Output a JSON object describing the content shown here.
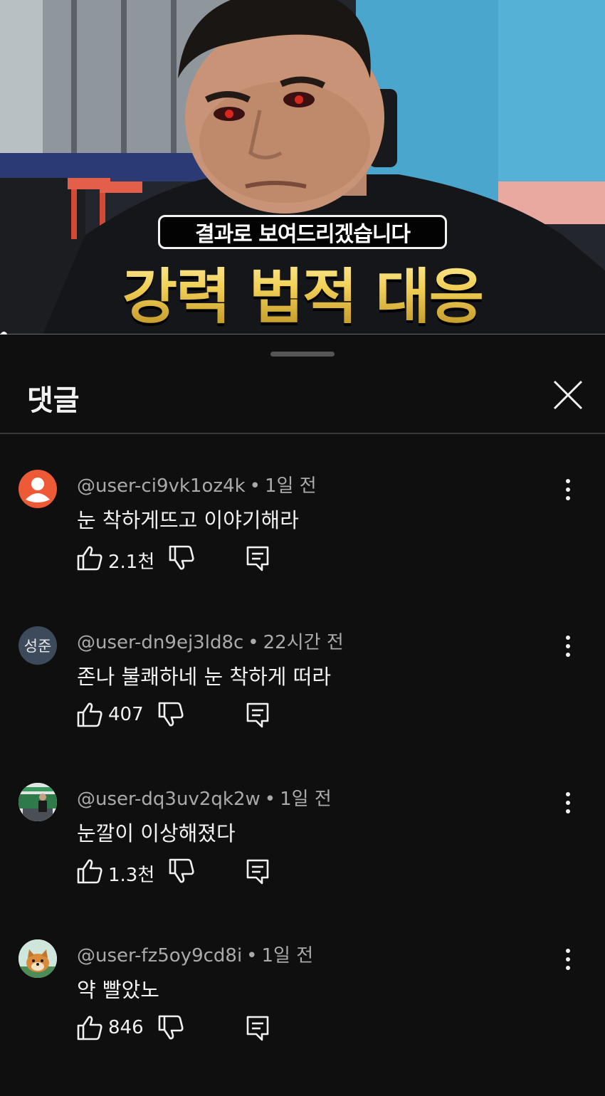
{
  "video": {
    "caption": "결과로 보여드리겠습니다",
    "headline": "강력 법적 대응",
    "progress_fraction": 0.005
  },
  "sheet": {
    "title": "댓글"
  },
  "comments": [
    {
      "author": "@user-ci9vk1oz4k",
      "time": "1일 전",
      "text": "눈 착하게뜨고 이야기해라",
      "likes": "2.1천",
      "avatar": "default-person-icon",
      "avatar_color": "#ef5a36"
    },
    {
      "author": "@user-dn9ej3ld8c",
      "time": "22시간 전",
      "text": "존나 불쾌하네 눈 착하게 떠라",
      "likes": "407",
      "avatar_initials": "성준",
      "avatar_color": "#3d4a5b"
    },
    {
      "author": "@user-dq3uv2qk2w",
      "time": "1일 전",
      "text": "눈깔이 이상해졌다",
      "likes": "1.3천",
      "avatar": "photo-avatar"
    },
    {
      "author": "@user-fz5oy9cd8i",
      "time": "1일 전",
      "text": "약 빨았노",
      "likes": "846",
      "avatar": "dog-photo-avatar"
    }
  ]
}
